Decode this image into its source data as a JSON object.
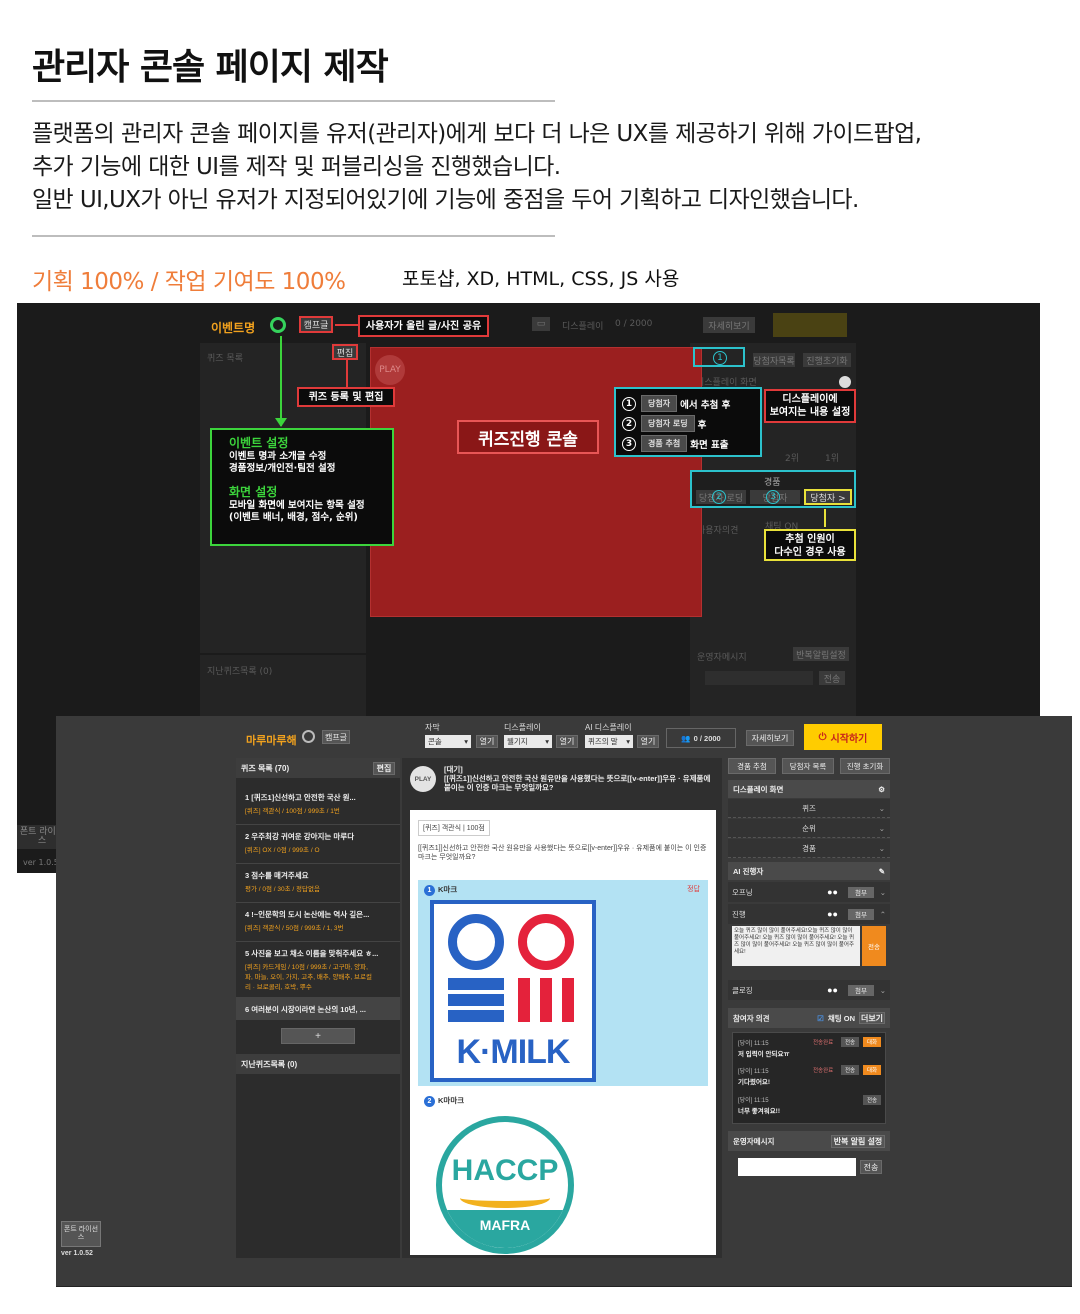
{
  "page": {
    "title": "관리자 콘솔 페이지 제작",
    "description": [
      "플랫폼의 관리자 콘솔 페이지를 유저(관리자)에게 보다 더 나은 UX를 제공하기 위해 가이드팝업,",
      "추가 기능에 대한 UI를 제작 및 퍼블리싱을 진행했습니다.",
      "일반 UI,UX가 아닌 유저가 지정되어있기에 기능에 중점을 두어 기획하고 디자인했습니다."
    ],
    "contribution": "기획 100% / 작업 기여도 100%",
    "tools": "포토샵, XD, HTML, CSS, JS 사용",
    "accent_color": "#ef7d3a"
  },
  "annotated_screenshot": {
    "brand": "이벤트명",
    "intro_chip": "캠프글",
    "display_label": "디스플레이",
    "counter": "0 / 2000",
    "detail_btn": "자세히보기",
    "quiz_list_label": "퀴즈 목록",
    "edit_btn": "편집",
    "play_label": "PLAY",
    "past_quiz_label": "지난퀴즈목록 (0)",
    "center_label": "퀴즈진행 콘솔",
    "callouts": {
      "user_post": "사용자가 올린 글/사진 공유",
      "quiz_register": "퀴즈 등록 및 편집",
      "event_settings_title": "이벤트 설정",
      "event_settings_lines": [
        "이벤트 명과 소개글 수정",
        "경품정보/개인전·팀전 설정"
      ],
      "screen_settings_title": "화면 설정",
      "screen_settings_lines": [
        "모바일 화면에 보여지는 항목 설정",
        "(이벤트 배너, 배경, 점수, 순위)"
      ],
      "display_settings": [
        "디스플레이에",
        "보여지는 내용 설정"
      ],
      "steps": [
        {
          "num": "1",
          "chip": "당첨자",
          "text": "에서 추첨 후"
        },
        {
          "num": "2",
          "chip": "당첨자 로딩",
          "text": "후"
        },
        {
          "num": "3",
          "chip": "경품 추첨",
          "text": "화면 표출"
        }
      ],
      "multi_winner": [
        "추첨 인원이",
        "다수인 경우 사용"
      ]
    },
    "right_tabs": [
      "경품 추첨",
      "당첨자목록",
      "진행초기화"
    ],
    "prize_label": "경품",
    "prize_btns": [
      "당첨자 로딩",
      "당첨자",
      "당첨자 >"
    ],
    "participant_label": "사용자의견",
    "chat_on": "채팅 ON",
    "op_msg_label": "운영자메시지",
    "repeat_btn": "반복알림설정",
    "send_btn": "전송",
    "display_screen_label": "디스플레이 화면",
    "rank_labels": [
      "2위",
      "1위"
    ],
    "license": "폰트 라이선스",
    "version": "ver 1.0.52"
  },
  "admin": {
    "brand": "마루마루해",
    "intro_btn": "캠프글",
    "subtitle_label": "자막",
    "subtitle_select": "콘솔",
    "display_label": "디스플레이",
    "display_select": "웰기지",
    "ai_display_label": "AI 디스플레이",
    "ai_select": "퀴즈의 말",
    "open_btn": "열기",
    "counter": "0 / 2000",
    "detail_btn": "자세히보기",
    "start_btn": "시작하기",
    "quiz_list": {
      "header": "퀴즈 목록 (70)",
      "edit_btn": "편집",
      "items": [
        {
          "title": "1  [퀴즈1]신선하고 안전한 국산 원...",
          "sub": "[퀴즈] 객관식 / 100점 / 999초 / 1번"
        },
        {
          "title": "2  우주최강 귀여운 강아지는 마루다",
          "sub": "[퀴즈] OX / 0점 / 999초 / O"
        },
        {
          "title": "3  점수를 매겨주세요",
          "sub": "평가 / 0점 / 30초 / 정답없음"
        },
        {
          "title": "4  !~인문학의 도시 논산에는 역사 깊은...",
          "sub": "[퀴즈] 객관식 / 50점 / 999초 / 1, 3번"
        },
        {
          "title": "5  사진을 보고 채소 이름을 맞춰주세요 ㅎ...",
          "sub": "[퀴즈] 카드게임 / 10점 / 999초 / 고구마, 양파,",
          "sub2": "파, 마늘, 오이, 가지, 고추, 배추, 양배추, 브로컬",
          "sub3": "리 · 브로콜리, 호박, 뿌수"
        },
        {
          "title": "6  여러분이 시장이라면 논산의 10년, ...",
          "sub": ""
        }
      ],
      "add_btn": "+",
      "past_header": "지난퀴즈목록 (0)"
    },
    "current_quiz": {
      "play": "PLAY",
      "status": "[대기]",
      "question": "[[퀴즈1]]신선하고 안전한 국산 원유만을 사용했다는 뜻으로[[v-enter]]우유 · 유제품에 붙이는 이 인증 마크는 무엇일까요?",
      "chip": "[퀴즈] 객관식 | 100점",
      "card_question": "[[퀴즈1]]신선하고 안전한 국산 원유만을 사용했다는 뜻으로[[v-enter]]우유 · 유제품에 붙이는 이 인증 마크는 무엇일까요?",
      "answer1_num": "1",
      "answer1_label": "K마크",
      "correct": "정답",
      "kmilk_text": "K·MILK",
      "answer2_num": "2",
      "answer2_label": "K마마크",
      "haccp_text": "HACCP",
      "haccp_band": "MAFRA"
    },
    "right": {
      "tabs": [
        "경품 추첨",
        "당첨자 목록",
        "진행 초기화"
      ],
      "display_header": "디스플레이 화면",
      "display_rows": [
        "퀴즈",
        "순위",
        "경품"
      ],
      "ai_header": "AI 진행자",
      "ai_rows": [
        {
          "label": "오프닝",
          "btn": "첨부"
        },
        {
          "label": "진행",
          "btn": "첨부"
        },
        {
          "label": "클로징",
          "btn": "첨부"
        }
      ],
      "ai_text": "오늘 퀴즈 많이 많이 풀어주세요!오늘 퀴즈 많이 많이 풀어주세요! 오늘 퀴즈 많이 많이 풀어주세요! 오늘 퀴즈 많이 많이 풀어주세요! 오늘 퀴즈 많이 많이 풀어주세요!",
      "ai_send": "전송",
      "opinion_header": "참여자 의견",
      "chat_on": "채팅 ON",
      "more_btn": "더보기",
      "chats": [
        {
          "meta": "[당이] 11:15",
          "msg": "저 입력이 안되요ㅠ",
          "tag": "전송완료",
          "b1": "전송",
          "b2": "대화"
        },
        {
          "meta": "[당이] 11:15",
          "msg": "기다렸어요!",
          "tag": "전송완료",
          "b1": "전송",
          "b2": "대화"
        },
        {
          "meta": "[당이] 11:15",
          "msg": "너무 좋겨워요!!",
          "tag": "",
          "b1": "전송",
          "b2": ""
        }
      ],
      "opmsg_header": "운영자메시지",
      "repeat_btn": "반복 알림 설정",
      "send_btn": "전송"
    },
    "license": "폰트 라이선스",
    "version": "ver 1.0.52"
  }
}
